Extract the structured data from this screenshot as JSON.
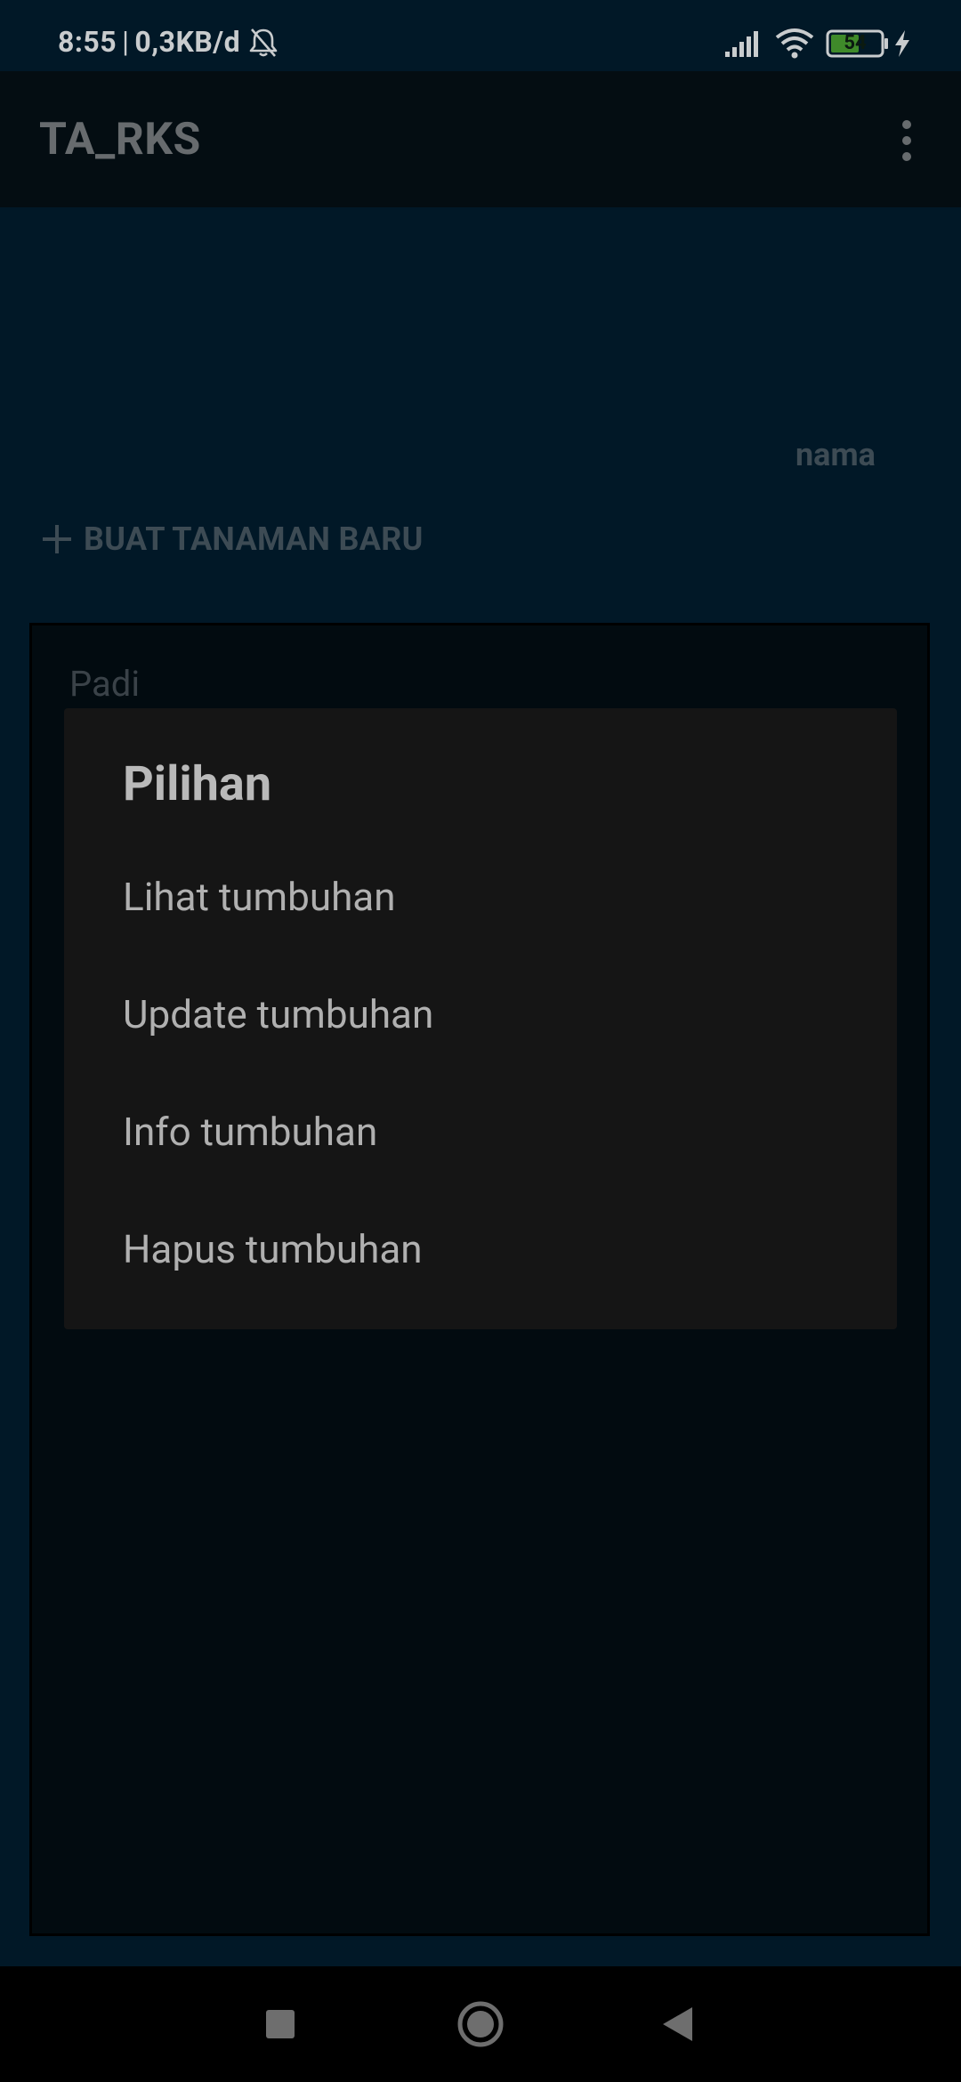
{
  "status_bar": {
    "time": "8:55",
    "separator": "|",
    "network_speed": "0,3KB/d",
    "battery_level": "54",
    "icons": [
      "bell-off-icon",
      "signal-icon",
      "wifi-icon",
      "battery-icon",
      "charging-bolt-icon"
    ]
  },
  "app_bar": {
    "title": "TA_RKS",
    "menu_icon": "overflow-menu-icon"
  },
  "main": {
    "name_label": "nama",
    "create_button_label": "BUAT TANAMAN BARU",
    "list_items": [
      {
        "label": "Padi"
      }
    ]
  },
  "dialog": {
    "title": "Pilihan",
    "items": [
      {
        "label": "Lihat tumbuhan"
      },
      {
        "label": "Update tumbuhan"
      },
      {
        "label": "Info tumbuhan"
      },
      {
        "label": "Hapus tumbuhan"
      }
    ]
  },
  "nav_bar": {
    "icons": [
      "recents-icon",
      "home-icon",
      "back-icon"
    ]
  },
  "colors": {
    "background": "#011827",
    "app_bar": "#040d12",
    "dialog": "#151515",
    "battery_fill": "#3f8a2a"
  }
}
